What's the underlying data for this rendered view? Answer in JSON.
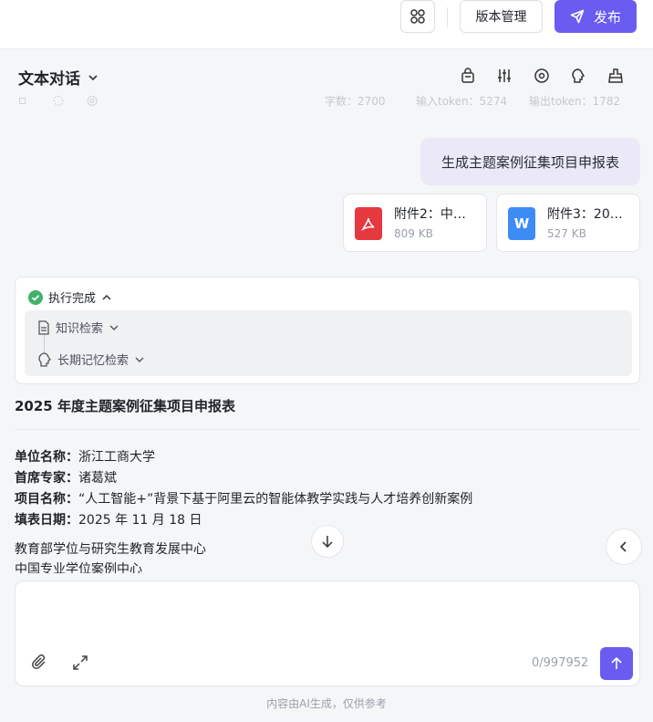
{
  "topbar": {
    "version_label": "版本管理",
    "publish_label": "发布"
  },
  "subheader": {
    "mode_title": "文本对话",
    "tools": [
      "store-icon",
      "sliders-icon",
      "settings-icon",
      "memory-icon",
      "clean-icon"
    ]
  },
  "faded_stats": {
    "a": "字数：2700",
    "b": "输入token：5274",
    "c": "输出token：1782"
  },
  "chat": {
    "user_message": "生成主题案例征集项目申报表",
    "attachments": [
      {
        "name": "附件2：中…",
        "size": "809 KB",
        "type": "pdf",
        "color": "#e5393f"
      },
      {
        "name": "附件3：20…",
        "size": "527 KB",
        "type": "word",
        "color": "#3d8bf5"
      }
    ],
    "exec": {
      "status": "执行完成",
      "steps": [
        "知识检索",
        "长期记忆检索"
      ]
    },
    "doc": {
      "title": "2025 年度主题案例征集项目申报表",
      "fields": [
        {
          "label": "单位名称：",
          "value": "浙江工商大学"
        },
        {
          "label": "首席专家：",
          "value": "诸葛斌"
        },
        {
          "label": "项目名称：",
          "value": "“人工智能+”背景下基于阿里云的智能体教学实践与人才培养创新案例"
        },
        {
          "label": "填表日期：",
          "value": "2025 年 11 月 18 日"
        }
      ],
      "lines": [
        "教育部学位与研究生教育发展中心",
        "中国专业学位案例中心"
      ]
    }
  },
  "input": {
    "placeholder": "",
    "counter": "0/997952"
  },
  "footer_note": "内容由AI生成，仅供参考",
  "colors": {
    "accent": "#6a5cf0"
  }
}
